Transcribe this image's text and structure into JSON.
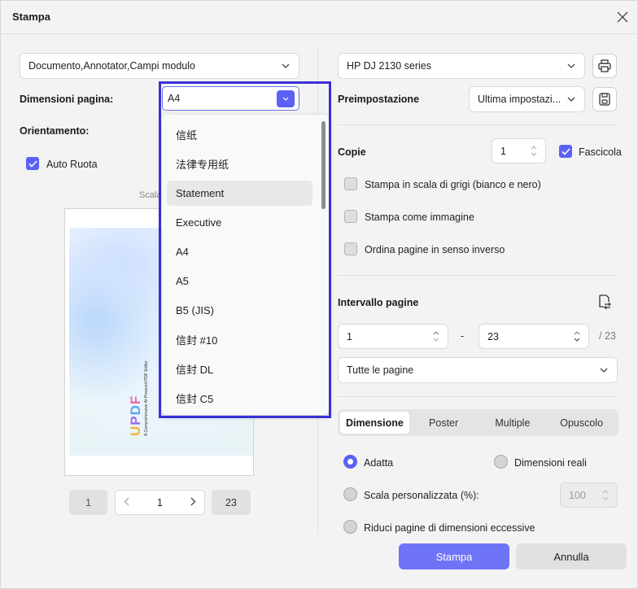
{
  "window": {
    "title": "Stampa"
  },
  "left": {
    "content_select": "Documento,Annotator,Campi modulo",
    "page_size_label": "Dimensioni pagina:",
    "page_size_value": "A4",
    "orientation_label": "Orientamento:",
    "auto_rotate_label": "Auto Ruota",
    "auto_rotate_checked": true,
    "scale_label_partial": "Scala",
    "preview": {
      "brand": [
        "U",
        "P",
        "D",
        "F"
      ],
      "tagline": "A Comprehensive AI-Powered PDF Editor"
    },
    "pager": {
      "first": "1",
      "current": "1",
      "last": "23"
    }
  },
  "dropdown": {
    "items": [
      "信纸",
      "法律专用纸",
      "Statement",
      "Executive",
      "A4",
      "A5",
      "B5 (JIS)",
      "信封 #10",
      "信封 DL",
      "信封 C5"
    ],
    "highlighted_index": 2
  },
  "right": {
    "printer": "HP DJ 2130 series",
    "preset_label": "Preimpostazione",
    "preset_value": "Ultima impostazi...",
    "copies_label": "Copie",
    "copies_value": "1",
    "collate_label": "Fascicola",
    "collate_checked": true,
    "options": [
      {
        "label": "Stampa in scala di grigi (bianco e nero)",
        "checked": false
      },
      {
        "label": "Stampa come immagine",
        "checked": false
      },
      {
        "label": "Ordina pagine in senso inverso",
        "checked": false
      }
    ],
    "range_label": "Intervallo pagine",
    "range_from": "1",
    "range_dash": "-",
    "range_to": "23",
    "range_total": "/ 23",
    "range_select": "Tutte le pagine",
    "tabs": [
      "Dimensione",
      "Poster",
      "Multiple",
      "Opuscolo"
    ],
    "active_tab": 0,
    "fit_label": "Adatta",
    "real_size_label": "Dimensioni reali",
    "custom_scale_label": "Scala personalizzata (%):",
    "custom_scale_value": "100",
    "shrink_label": "Riduci pagine di dimensioni eccessive"
  },
  "footer": {
    "print_button": "Stampa",
    "cancel_button": "Annulla"
  },
  "colors": {
    "accent": "#5b61f5",
    "primary_button": "#6f74f7",
    "highlight_frame": "#3730d6"
  }
}
